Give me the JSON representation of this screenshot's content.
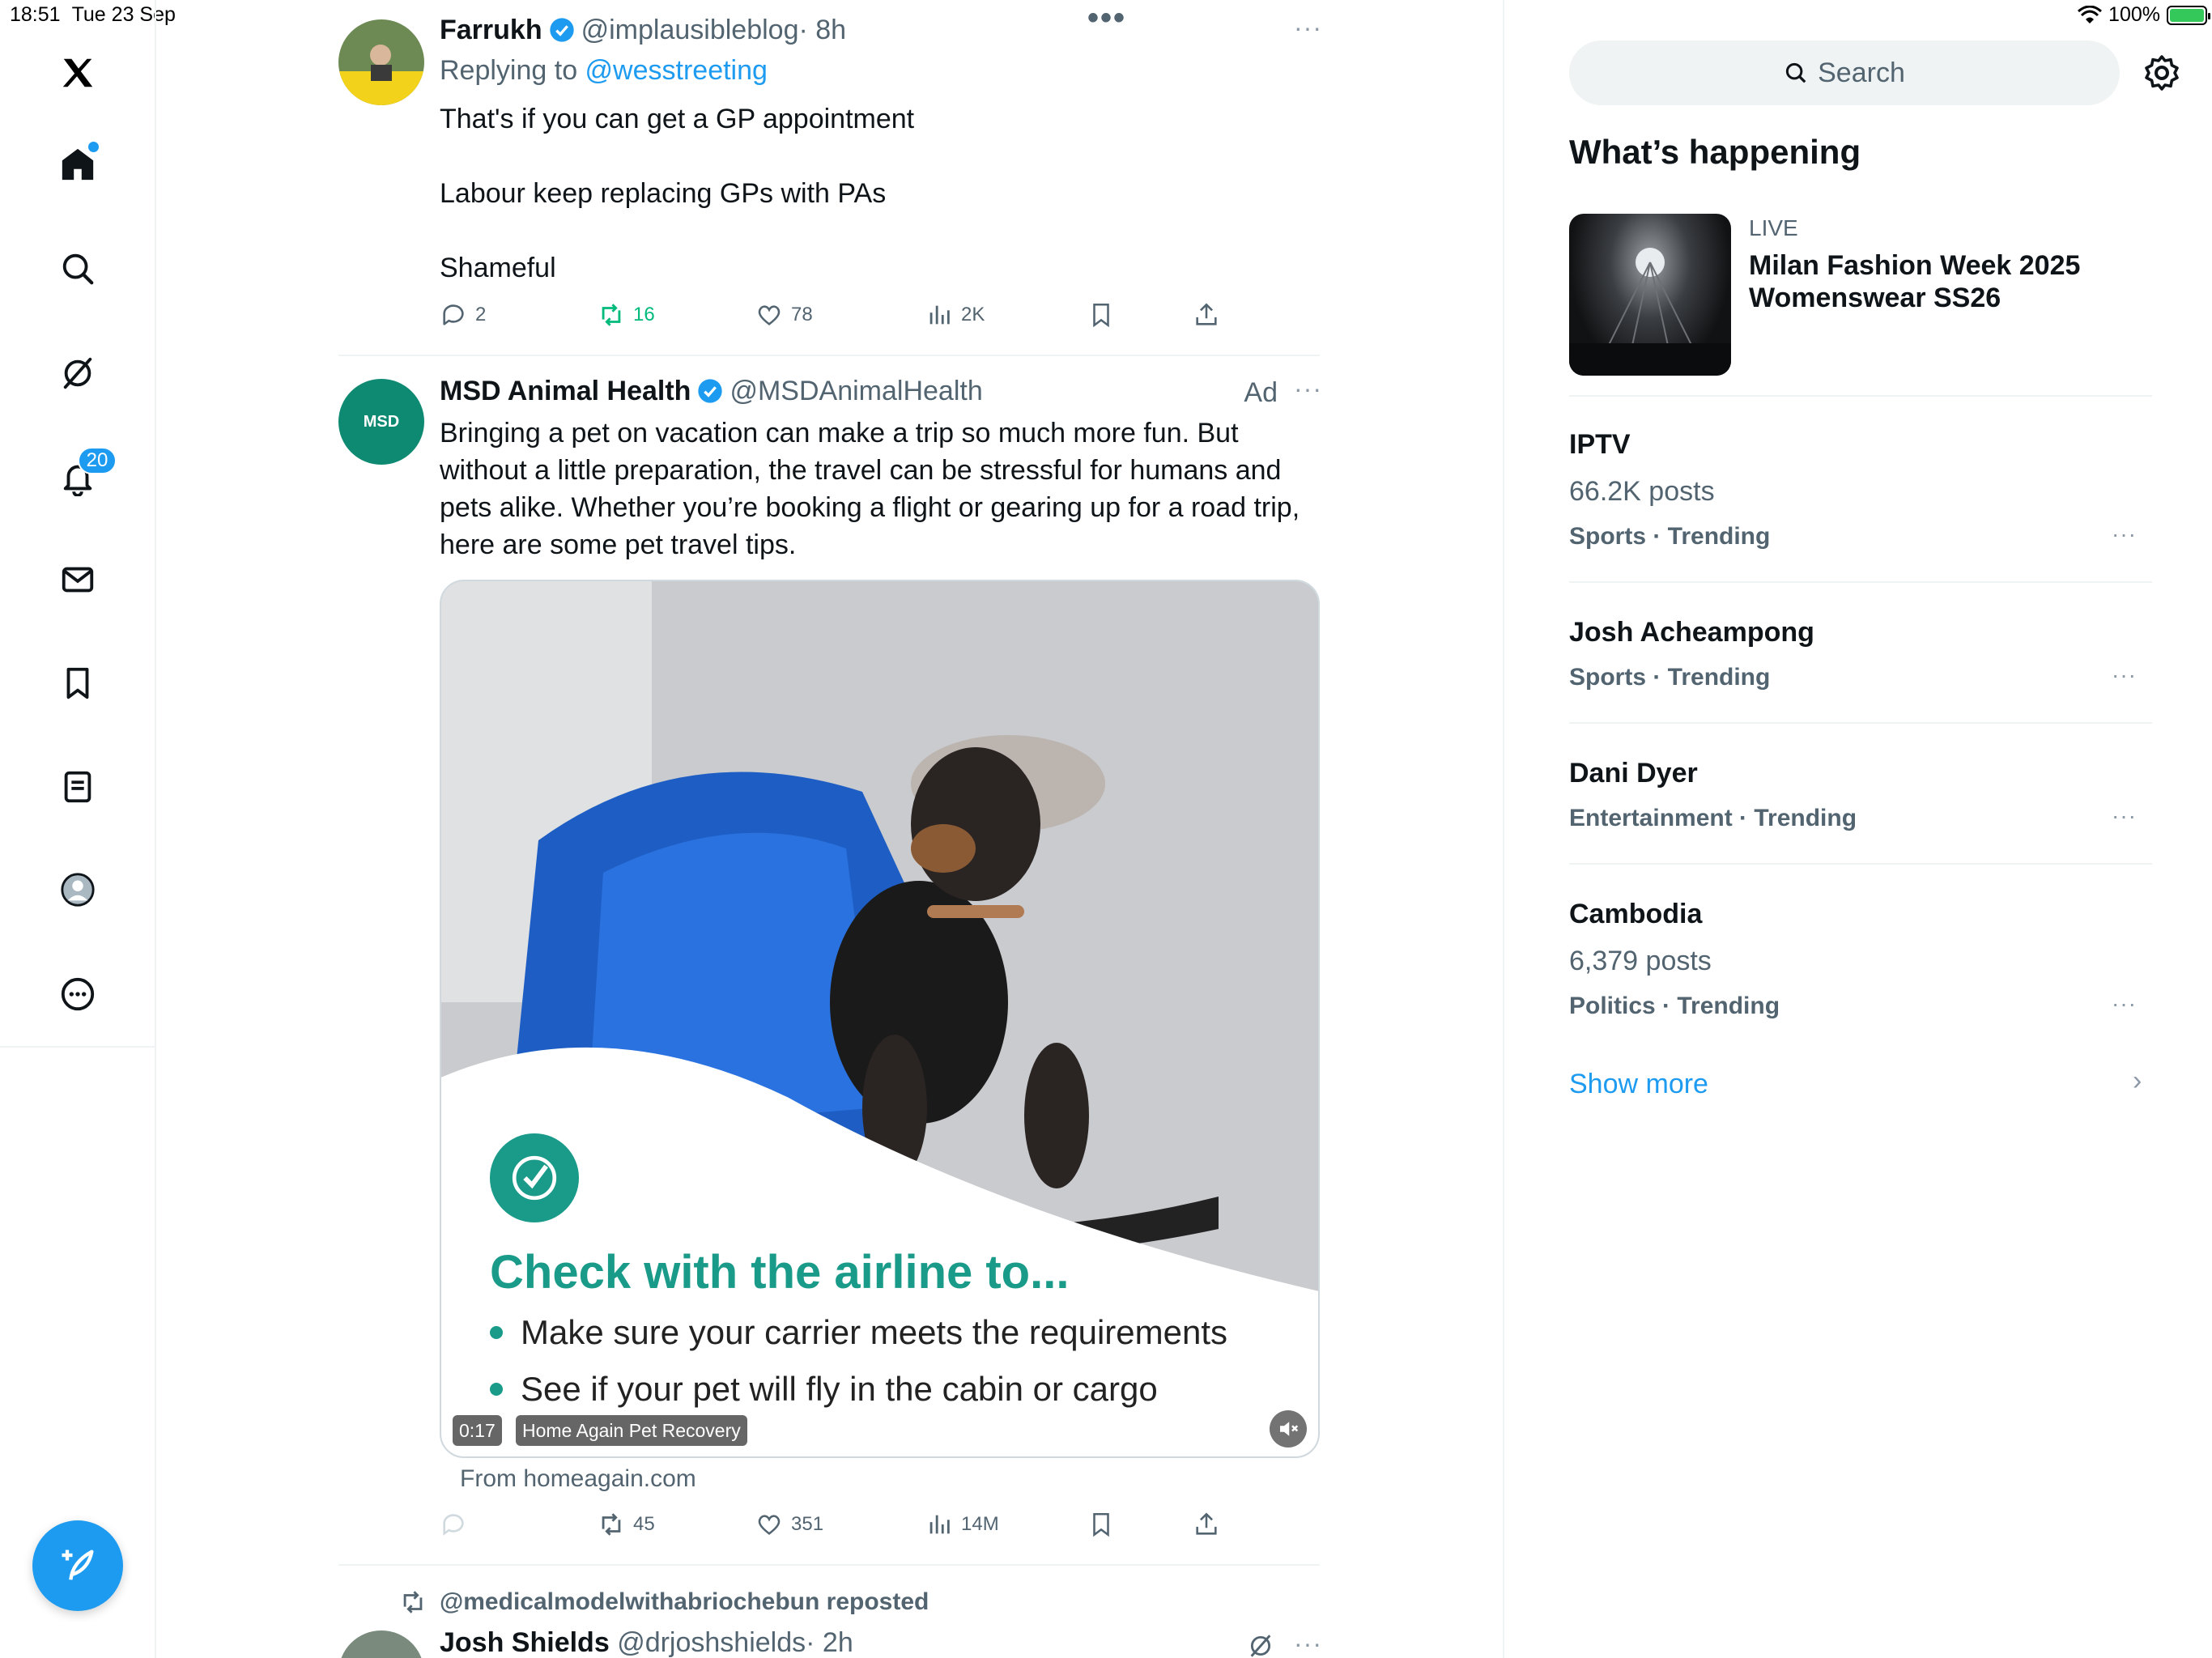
{
  "status_bar": {
    "time": "18:51",
    "date": "Tue 23 Sep",
    "battery": "100%",
    "battery_level": 1.0
  },
  "nav": {
    "notifications_badge": "20",
    "icons": [
      "x-logo-icon",
      "home-icon",
      "search-icon",
      "grok-icon",
      "bell-icon",
      "mail-icon",
      "bookmark-icon",
      "lists-icon",
      "profile-icon",
      "more-icon",
      "compose-icon"
    ]
  },
  "feed": {
    "tweet1": {
      "name": "Farrukh",
      "handle": "@implausibleblog",
      "time": "· 8h",
      "replying_prefix": "Replying to ",
      "replying_to": "@wesstreeting",
      "text": "That's if you can get a GP appointment\n\nLabour keep replacing GPs with PAs\n\nShameful",
      "replies": "2",
      "reposts": "16",
      "likes": "78",
      "views": "2K"
    },
    "ad": {
      "name": "MSD Animal Health",
      "handle": "@MSDAnimalHealth",
      "ad_label": "Ad",
      "avatar_text": "MSD",
      "text": "Bringing a pet on vacation can make a trip so much more fun. But without a little preparation, the travel can be stressful for humans and pets alike. Whether you’re booking a flight or gearing up for a road trip, here are some pet travel tips.",
      "media_title": "Check with the airline to...",
      "bullet1": "Make sure your carrier meets the requirements",
      "bullet2": "See if your pet will fly in the cabin or cargo",
      "video_time": "0:17",
      "video_source": "Home Again Pet Recovery",
      "from": "From homeagain.com",
      "reposts": "45",
      "likes": "351",
      "views": "14M"
    },
    "tweet3": {
      "repost_by": "@medicalmodelwithabriochebun reposted",
      "name": "Josh Shields",
      "handle": "@drjoshshields",
      "time": "· 2h"
    }
  },
  "sidebar": {
    "search_placeholder": "Search",
    "title": "What’s happening",
    "event": {
      "label": "LIVE",
      "title": "Milan Fashion Week 2025 Womenswear SS26"
    },
    "trends": [
      {
        "name": "IPTV",
        "count": "66.2K posts",
        "category": "Sports · Trending"
      },
      {
        "name": "Josh Acheampong",
        "count": "",
        "category": "Sports · Trending"
      },
      {
        "name": "Dani Dyer",
        "count": "",
        "category": "Entertainment · Trending"
      },
      {
        "name": "Cambodia",
        "count": "6,379 posts",
        "category": "Politics · Trending"
      }
    ],
    "show_more": "Show more"
  },
  "colors": {
    "accent": "#1d9bf0",
    "repost_green": "#00ba7c",
    "ad_teal": "#1a9b8a"
  }
}
